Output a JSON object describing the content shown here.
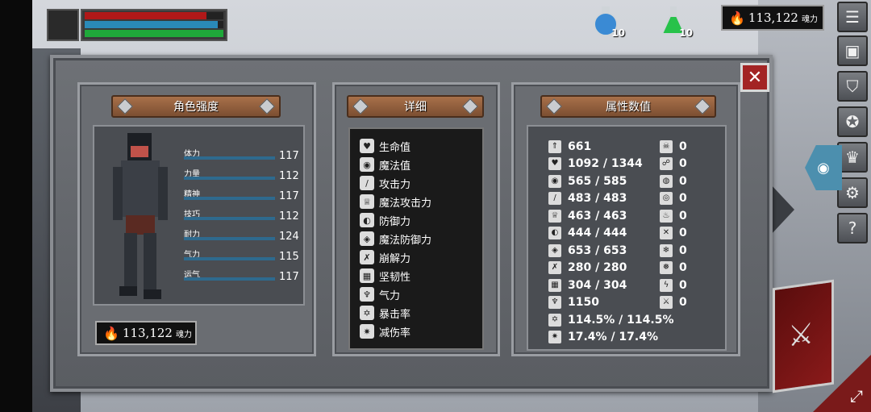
{
  "hud": {
    "hp_fill": 0.88,
    "mp_fill": 0.96,
    "stamina_fill": 1.0,
    "colors": {
      "hp": "#b01818",
      "mp": "#2a8ab8",
      "stamina": "#1fa83a"
    }
  },
  "potions": [
    {
      "icon": "blue-potion-icon",
      "count": "10",
      "color": "#3a8ad4"
    },
    {
      "icon": "green-potion-icon",
      "count": "10",
      "color": "#27c24a"
    }
  ],
  "currency": {
    "amount": "113,122",
    "unit": "魂力",
    "icon": "flame-icon"
  },
  "menu": [
    {
      "icon": "list-icon",
      "glyph": "☰"
    },
    {
      "icon": "armor-icon",
      "glyph": "▣"
    },
    {
      "icon": "helmet-icon",
      "glyph": "⛉"
    },
    {
      "icon": "compass-icon",
      "glyph": "✪"
    },
    {
      "icon": "crown-icon",
      "glyph": "♛"
    },
    {
      "icon": "gear-icon",
      "glyph": "⚙"
    },
    {
      "icon": "help-icon",
      "glyph": "?"
    }
  ],
  "panels": {
    "character": {
      "title": "角色强度"
    },
    "details": {
      "title": "详细"
    },
    "attributes": {
      "title": "属性数值"
    }
  },
  "stats": [
    {
      "label": "体力",
      "value": "117"
    },
    {
      "label": "力量",
      "value": "112"
    },
    {
      "label": "精神",
      "value": "117"
    },
    {
      "label": "技巧",
      "value": "112"
    },
    {
      "label": "耐力",
      "value": "124"
    },
    {
      "label": "气力",
      "value": "115"
    },
    {
      "label": "运气",
      "value": "117"
    }
  ],
  "details": [
    {
      "label": "生命值",
      "icon": "heart-icon",
      "glyph": "♥"
    },
    {
      "label": "魔法值",
      "icon": "mana-icon",
      "glyph": "◉"
    },
    {
      "label": "攻击力",
      "icon": "sword-icon",
      "glyph": "/"
    },
    {
      "label": "魔法攻击力",
      "icon": "magic-attack-icon",
      "glyph": "♕"
    },
    {
      "label": "防御力",
      "icon": "shield-icon",
      "glyph": "◐"
    },
    {
      "label": "魔法防御力",
      "icon": "magic-shield-icon",
      "glyph": "◈"
    },
    {
      "label": "崩解力",
      "icon": "break-icon",
      "glyph": "✗"
    },
    {
      "label": "坚韧性",
      "icon": "toughness-icon",
      "glyph": "▦"
    },
    {
      "label": "气力",
      "icon": "lungs-icon",
      "glyph": "♆"
    },
    {
      "label": "暴击率",
      "icon": "critical-icon",
      "glyph": "✡"
    },
    {
      "label": "减伤率",
      "icon": "damage-reduction-icon",
      "glyph": "✷"
    }
  ],
  "attributes_left": [
    {
      "value": "661",
      "icon": "level-icon",
      "glyph": "⇑"
    },
    {
      "value": "1092 / 1344",
      "icon": "heart-icon",
      "glyph": "♥"
    },
    {
      "value": "565 / 585",
      "icon": "mana-icon",
      "glyph": "◉"
    },
    {
      "value": "483 / 483",
      "icon": "sword-icon",
      "glyph": "/"
    },
    {
      "value": "463 / 463",
      "icon": "magic-attack-icon",
      "glyph": "♕"
    },
    {
      "value": "444 / 444",
      "icon": "shield-icon",
      "glyph": "◐"
    },
    {
      "value": "653 / 653",
      "icon": "magic-shield-icon",
      "glyph": "◈"
    },
    {
      "value": "280 / 280",
      "icon": "break-icon",
      "glyph": "✗"
    },
    {
      "value": "304 / 304",
      "icon": "toughness-icon",
      "glyph": "▦"
    },
    {
      "value": "1150",
      "icon": "lungs-icon",
      "glyph": "♆"
    },
    {
      "value": "114.5% / 114.5%",
      "icon": "critical-icon",
      "glyph": "✡"
    },
    {
      "value": "17.4% / 17.4%",
      "icon": "damage-reduction-icon",
      "glyph": "✷"
    }
  ],
  "attributes_right": [
    {
      "value": "0",
      "icon": "skull-icon",
      "glyph": "☠"
    },
    {
      "value": "0",
      "icon": "poison-icon",
      "glyph": "☍"
    },
    {
      "value": "0",
      "icon": "water-drop-icon",
      "glyph": "◍"
    },
    {
      "value": "0",
      "icon": "bleed-icon",
      "glyph": "◎"
    },
    {
      "value": "0",
      "icon": "fire-icon",
      "glyph": "♨"
    },
    {
      "value": "0",
      "icon": "cross-swords-icon",
      "glyph": "✕"
    },
    {
      "value": "0",
      "icon": "frost-icon",
      "glyph": "❄"
    },
    {
      "value": "0",
      "icon": "ice-icon",
      "glyph": "❅"
    },
    {
      "value": "0",
      "icon": "lightning-icon",
      "glyph": "ϟ"
    },
    {
      "value": "0",
      "icon": "slash-icon",
      "glyph": "⚔"
    }
  ]
}
